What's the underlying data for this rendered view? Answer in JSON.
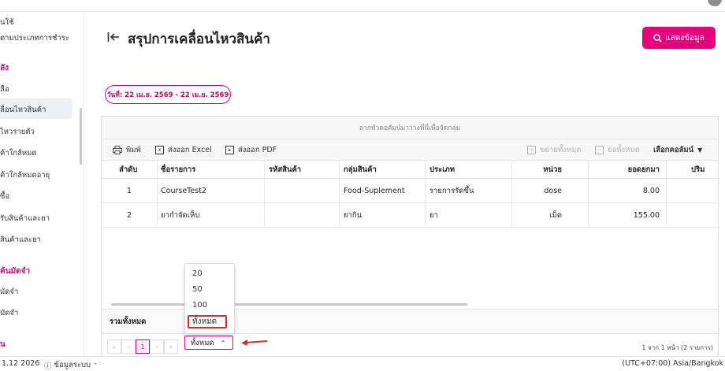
{
  "sidebar": {
    "items": [
      {
        "label": "นใช้"
      },
      {
        "label": "ตามประเภทการชำระ"
      },
      {
        "label": "ลือ"
      },
      {
        "label": "ลื่อนไหวสินค้า"
      },
      {
        "label": "ไหวรายตัว"
      },
      {
        "label": "ค้าใกล้หมด"
      },
      {
        "label": "ค้าใกล้หมดอายุ"
      },
      {
        "label": "ซื้อ"
      },
      {
        "label": "รับสินค้าและยา"
      },
      {
        "label": "สินค้าและยา"
      },
      {
        "label": "มัดจำ"
      },
      {
        "label": "มัดจำ"
      }
    ],
    "sections": [
      {
        "label": "ลัง"
      },
      {
        "label": "ค้นมัดจำ"
      },
      {
        "label": "น"
      }
    ]
  },
  "header": {
    "title": "สรุปการเคลื่อนไหวสินค้า",
    "show_button": "แสดงข้อมูล"
  },
  "filter": {
    "date_range": "วันที่: 22 เม.ย. 2569 - 22 เม.ย. 2569"
  },
  "grid": {
    "group_hint": "ลากหัวคอลัมน์มาวางที่นี่เพื่อจัดกลุ่ม",
    "toolbar": {
      "print": "พิมพ์",
      "export_excel": "ส่งออก Excel",
      "export_pdf": "ส่งออก PDF",
      "expand_all": "ขยายทั้งหมด",
      "collapse_all": "ย่อทั้งหมด",
      "choose_columns": "เลือกคอลัมน์"
    },
    "columns": [
      "ลำดับ",
      "ชื่อรายการ",
      "รหัสสินค้า",
      "กลุ่มสินค้า",
      "ประเภท",
      "หน่วย",
      "ยอดยกมา",
      "ปริม"
    ],
    "rows": [
      {
        "no": "1",
        "name": "CourseTest2",
        "code": "",
        "group": "Food-Suplement",
        "type": "รายการรัดขึ้น",
        "unit": "dose",
        "carried": "8.00"
      },
      {
        "no": "2",
        "name": "ยากำจัดเห็บ",
        "code": "",
        "group": "ยากิน",
        "type": "ยา",
        "unit": "เม็ด",
        "carried": "155.00"
      }
    ],
    "total_label": "รวมทั้งหมด",
    "pager": {
      "current_page": "1",
      "page_size": "ทั้งหมด",
      "info": "1 จาก 1 หน้า (2 รายการ)",
      "options": [
        "20",
        "50",
        "100",
        "ทั้งหมด"
      ]
    }
  },
  "statusbar": {
    "version": "1.12 2026",
    "system_info": "ข้อมูลระบบ",
    "timezone": "(UTC+07:00) Asia/Bangkok"
  },
  "colors": {
    "accent": "#e6007e",
    "highlight_box": "#d32f2f"
  }
}
